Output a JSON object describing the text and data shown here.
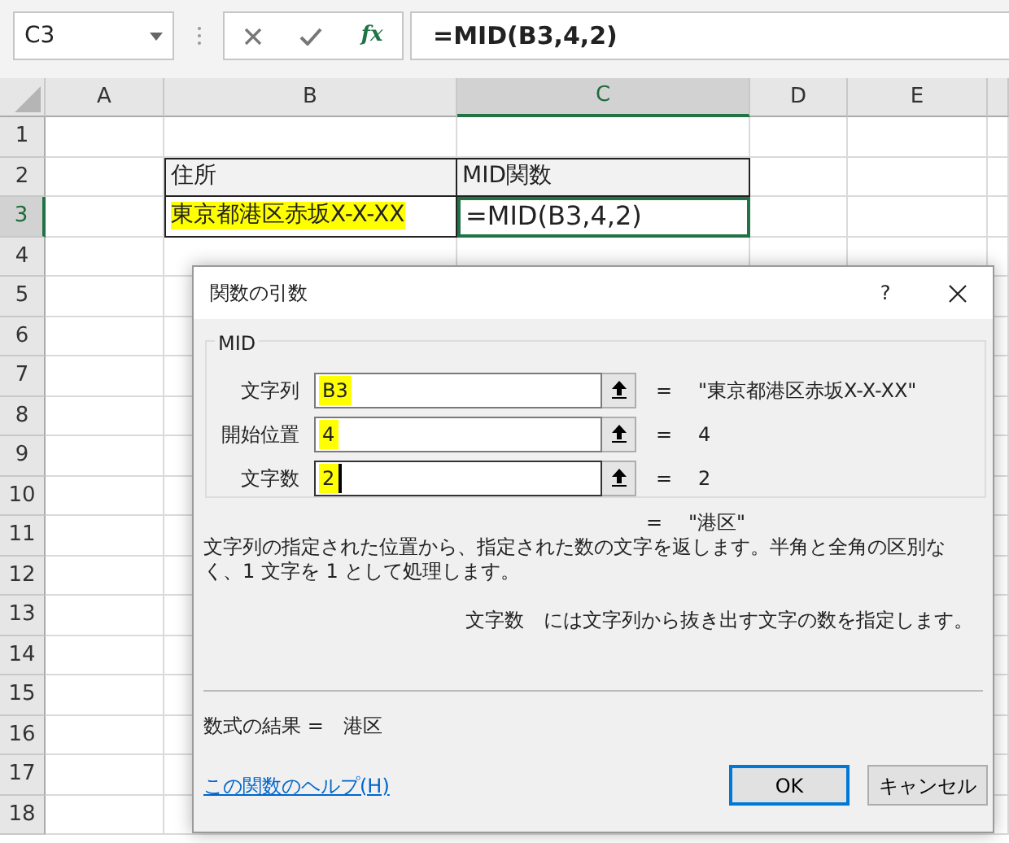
{
  "name_box": {
    "value": "C3"
  },
  "formula_bar": {
    "function_button": "fx",
    "value": "=MID(B3,4,2)"
  },
  "columns": [
    {
      "label": "A",
      "selected": false
    },
    {
      "label": "B",
      "selected": false
    },
    {
      "label": "C",
      "selected": true
    },
    {
      "label": "D",
      "selected": false
    },
    {
      "label": "E",
      "selected": false
    }
  ],
  "rows": [
    {
      "label": "1",
      "selected": false
    },
    {
      "label": "2",
      "selected": false,
      "cell_b": {
        "text": "住所",
        "highlighted": false,
        "selected": false
      },
      "cell_c": {
        "text": "MID関数",
        "highlighted": false,
        "selected": false
      }
    },
    {
      "label": "3",
      "selected": true,
      "cell_b": {
        "text": "東京都港区赤坂X-X-XX",
        "highlighted": true,
        "selected": false
      },
      "cell_c": {
        "text": "=MID(B3,4,2)",
        "highlighted": false,
        "selected": true
      }
    },
    {
      "label": "4",
      "selected": false
    },
    {
      "label": "5",
      "selected": false
    },
    {
      "label": "6",
      "selected": false
    },
    {
      "label": "7",
      "selected": false
    },
    {
      "label": "8",
      "selected": false
    },
    {
      "label": "9",
      "selected": false
    },
    {
      "label": "10",
      "selected": false
    },
    {
      "label": "11",
      "selected": false
    },
    {
      "label": "12",
      "selected": false
    },
    {
      "label": "13",
      "selected": false
    },
    {
      "label": "14",
      "selected": false
    },
    {
      "label": "15",
      "selected": false
    },
    {
      "label": "16",
      "selected": false
    },
    {
      "label": "17",
      "selected": false
    },
    {
      "label": "18",
      "selected": false
    }
  ],
  "dialog": {
    "title": "関数の引数",
    "help_glyph": "?",
    "function_name": "MID",
    "arguments": [
      {
        "label": "文字列",
        "value": "B3",
        "highlighted": true,
        "focused": false,
        "equals": "=",
        "result": "\"東京都港区赤坂X-X-XX\""
      },
      {
        "label": "開始位置",
        "value": "4",
        "highlighted": true,
        "focused": false,
        "equals": "=",
        "result": "4"
      },
      {
        "label": "文字数",
        "value": "2",
        "highlighted": true,
        "focused": true,
        "equals": "=",
        "result": "2"
      }
    ],
    "preview": {
      "equals": "=",
      "value": "\"港区\""
    },
    "description": "文字列の指定された位置から、指定された数の文字を返します。半角と全角の区別なく、1 文字を 1 として処理します。",
    "argument_help": {
      "name": "文字数",
      "text": "には文字列から抜き出す文字の数を指定します。"
    },
    "formula_result": {
      "label": "数式の結果 =",
      "value": "港区"
    },
    "help_link": "この関数のヘルプ(H)",
    "buttons": [
      {
        "label": "OK",
        "default": true
      },
      {
        "label": "キャンセル",
        "default": false
      }
    ]
  }
}
